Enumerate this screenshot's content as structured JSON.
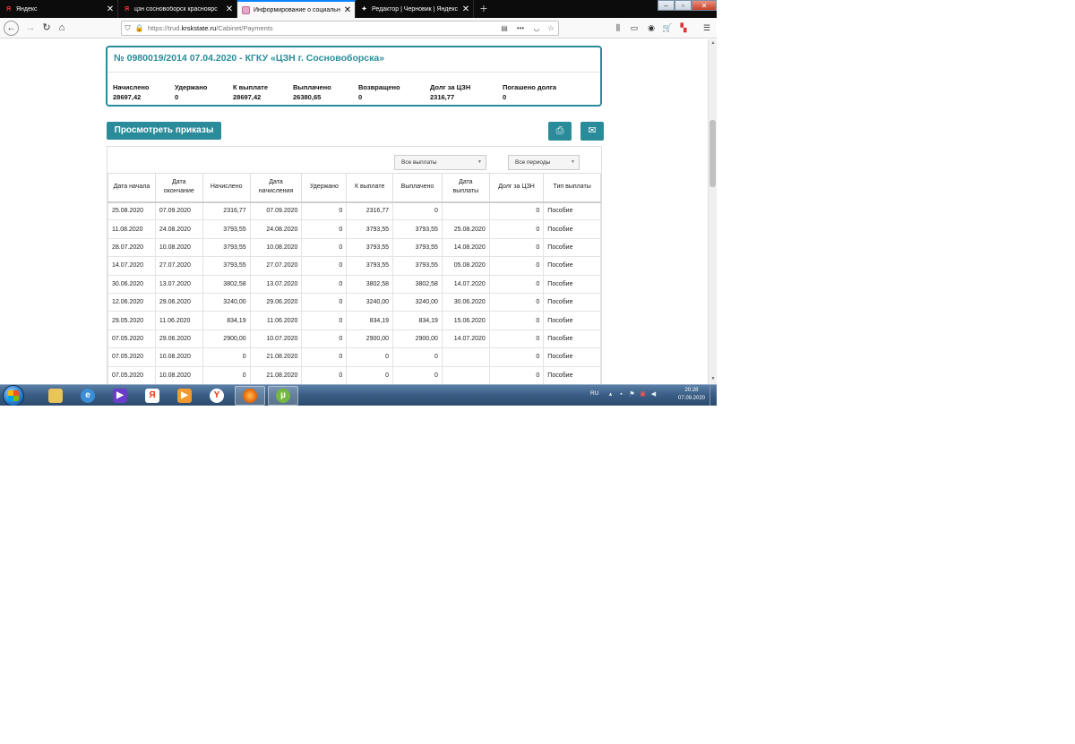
{
  "browser": {
    "tabs": [
      {
        "title": "Яндекс",
        "icon": "yandex-icon"
      },
      {
        "title": "цзн сосновоборск красноярс",
        "icon": "yandex-icon"
      },
      {
        "title": "Информирование о социальн",
        "icon": "page-icon",
        "active": true
      },
      {
        "title": "Редактор | Черновик | Яндекс",
        "icon": "zen-icon"
      }
    ],
    "close_glyph": "✕",
    "new_tab_glyph": "+",
    "url_prefix": "https://trud.",
    "url_domain": "krskstate.ru",
    "url_path": "/Cabinet/Payments",
    "more_glyph": "•••"
  },
  "contract": {
    "title": "№ 0980019/2014 07.04.2020 - КГКУ «ЦЗН г. Сосновоборска»",
    "summary": [
      {
        "label": "Начислено",
        "value": "28697,42"
      },
      {
        "label": "Удержано",
        "value": "0"
      },
      {
        "label": "К выплате",
        "value": "28697,42"
      },
      {
        "label": "Выплачено",
        "value": "26380,65"
      },
      {
        "label": "Возвращено",
        "value": "0"
      },
      {
        "label": "Долг за ЦЗН",
        "value": "2316,77"
      },
      {
        "label": "Погашено долга",
        "value": "0"
      }
    ]
  },
  "actions": {
    "orders_label": "Просмотреть приказы",
    "print_icon": "print-icon",
    "email_icon": "email-icon"
  },
  "filters": {
    "payments_select": "Все выплаты",
    "periods_select": "Все периоды"
  },
  "table": {
    "headers": [
      "Дата начала",
      "Дата окончание",
      "Начислено",
      "Дата начисления",
      "Удержано",
      "К выплате",
      "Выплачено",
      "Дата выплаты",
      "Долг за ЦЗН",
      "Тип выплаты"
    ],
    "rows": [
      [
        "25.08.2020",
        "07.09.2020",
        "2316,77",
        "07.09.2020",
        "0",
        "2316,77",
        "0",
        "",
        "0",
        "Пособие"
      ],
      [
        "11.08.2020",
        "24.08.2020",
        "3793,55",
        "24.08.2020",
        "0",
        "3793,55",
        "3793,55",
        "25.08.2020",
        "0",
        "Пособие"
      ],
      [
        "28.07.2020",
        "10.08.2020",
        "3793,55",
        "10.08.2020",
        "0",
        "3793,55",
        "3793,55",
        "14.08.2020",
        "0",
        "Пособие"
      ],
      [
        "14.07.2020",
        "27.07.2020",
        "3793,55",
        "27.07.2020",
        "0",
        "3793,55",
        "3793,55",
        "05.08.2020",
        "0",
        "Пособие"
      ],
      [
        "30.06.2020",
        "13.07.2020",
        "3802,58",
        "13.07.2020",
        "0",
        "3802,58",
        "3802,58",
        "14.07.2020",
        "0",
        "Пособие"
      ],
      [
        "12.06.2020",
        "29.06.2020",
        "3240,00",
        "29.06.2020",
        "0",
        "3240,00",
        "3240,00",
        "30.06.2020",
        "0",
        "Пособие"
      ],
      [
        "29.05.2020",
        "11.06.2020",
        "834,19",
        "11.06.2020",
        "0",
        "834,19",
        "834,19",
        "15.06.2020",
        "0",
        "Пособие"
      ],
      [
        "07.05.2020",
        "29.06.2020",
        "2900,00",
        "10.07.2020",
        "0",
        "2900,00",
        "2900,00",
        "14.07.2020",
        "0",
        "Пособие"
      ],
      [
        "07.05.2020",
        "10.08.2020",
        "0",
        "21.08.2020",
        "0",
        "0",
        "0",
        "",
        "0",
        "Пособие"
      ],
      [
        "07.05.2020",
        "10.08.2020",
        "0",
        "21.08.2020",
        "0",
        "0",
        "0",
        "",
        "0",
        "Пособие"
      ]
    ]
  },
  "taskbar": {
    "language": "RU",
    "time": "20:28",
    "date": "07.09.2020"
  }
}
